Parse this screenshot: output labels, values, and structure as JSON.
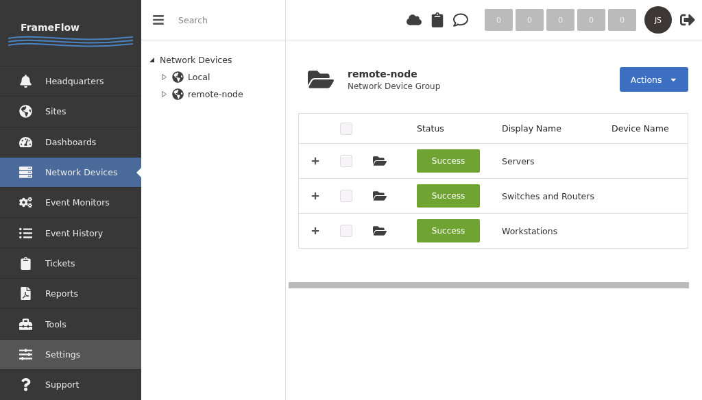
{
  "sidebar": {
    "logo": "FrameFlow",
    "items": [
      {
        "label": "Headquarters",
        "selected": false,
        "hovered": false
      },
      {
        "label": "Sites",
        "selected": false,
        "hovered": false
      },
      {
        "label": "Dashboards",
        "selected": false,
        "hovered": false
      },
      {
        "label": "Network Devices",
        "selected": true,
        "hovered": false
      },
      {
        "label": "Event Monitors",
        "selected": false,
        "hovered": false
      },
      {
        "label": "Event History",
        "selected": false,
        "hovered": false
      },
      {
        "label": "Tickets",
        "selected": false,
        "hovered": false
      },
      {
        "label": "Reports",
        "selected": false,
        "hovered": false
      },
      {
        "label": "Tools",
        "selected": false,
        "hovered": false
      },
      {
        "label": "Settings",
        "selected": false,
        "hovered": true
      },
      {
        "label": "Support",
        "selected": false,
        "hovered": false
      }
    ]
  },
  "tree_panel": {
    "search": {
      "placeholder": "Search"
    },
    "tree": [
      {
        "label": "Network Devices",
        "expanded": true,
        "children": [
          {
            "label": "Local",
            "expanded": false
          },
          {
            "label": "remote-node",
            "expanded": false
          }
        ]
      }
    ]
  },
  "top_bar": {
    "counters": [
      "0",
      "0",
      "0",
      "0",
      "0"
    ],
    "avatar": "JS"
  },
  "header": {
    "title": "remote-node",
    "subtitle": "Network Device Group",
    "actions_button": "Actions"
  },
  "table": {
    "columns": [
      "Status",
      "Display Name",
      "Device Name"
    ],
    "header_checked": false,
    "rows": [
      {
        "checked": false,
        "status": "Success",
        "display_name": "Servers"
      },
      {
        "checked": false,
        "status": "Success",
        "display_name": "Switches and Routers"
      },
      {
        "checked": false,
        "status": "Success",
        "display_name": "Workstations"
      }
    ]
  }
}
